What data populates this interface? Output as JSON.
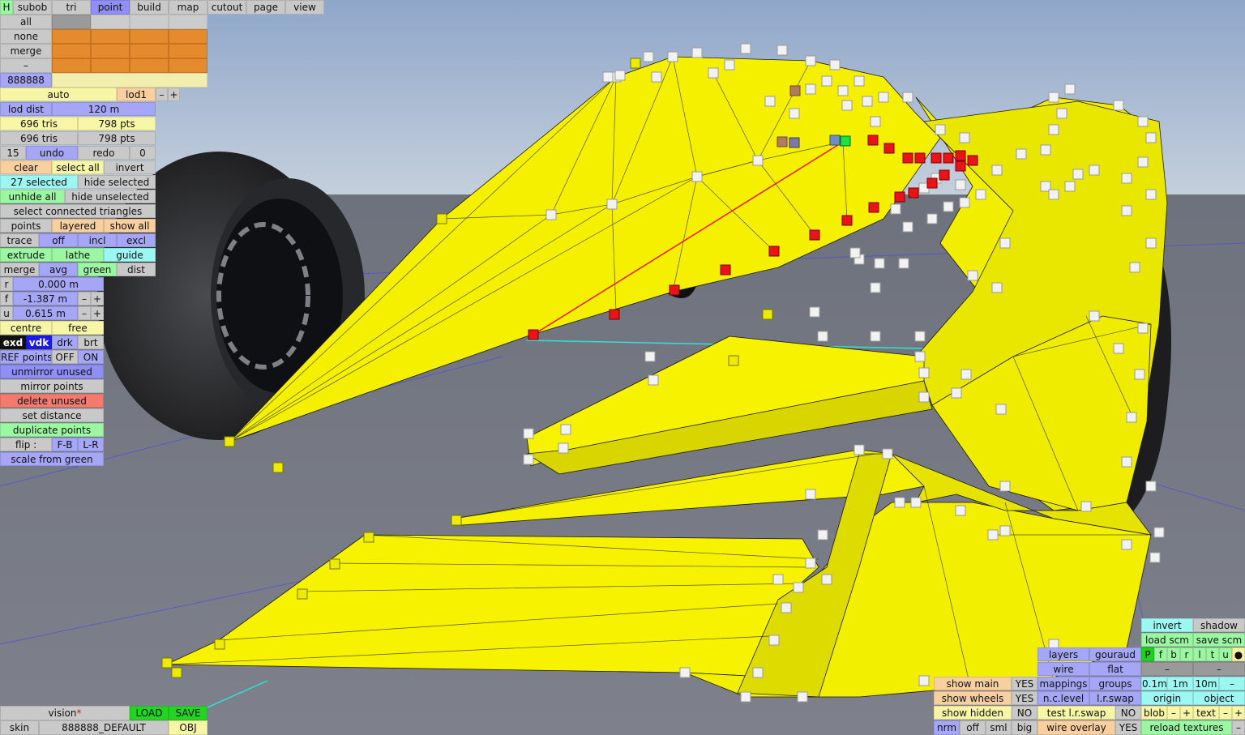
{
  "app": {
    "menu": [
      "H",
      "subob",
      "tri",
      "point",
      "build",
      "map",
      "cutout",
      "page",
      "view"
    ],
    "selectors": [
      "all",
      "none",
      "merge",
      "–"
    ],
    "hex_id": "888888"
  },
  "left_panel": {
    "auto": "auto",
    "lod": "lod1",
    "minus": "–",
    "plus": "+",
    "lod_dist_label": "lod dist",
    "lod_dist_value": "120 m",
    "tris_1": "696 tris",
    "pts_1": "798 pts",
    "tris_2": "696 tris",
    "pts_2": "798 pts",
    "undo_count": "15",
    "undo": "undo",
    "redo": "redo",
    "redo_count": "0",
    "clear": "clear",
    "select_all": "select all",
    "invert": "invert",
    "selected": "27 selected",
    "hide_selected": "hide selected",
    "unhide_all": "unhide all",
    "hide_unselected": "hide unselected",
    "select_connected": "select connected triangles",
    "points": "points",
    "layered": "layered",
    "show_all": "show all",
    "trace": "trace",
    "off": "off",
    "incl": "incl",
    "excl": "excl",
    "extrude": "extrude",
    "lathe": "lathe",
    "guide": "guide",
    "merge": "merge",
    "avg": "avg",
    "green": "green",
    "dist": "dist",
    "r_label": "r",
    "r_value": "0.000 m",
    "f_label": "f",
    "f_value": "-1.387 m",
    "u_label": "u",
    "u_value": "0.615 m",
    "centre": "centre",
    "free": "free",
    "exd": "exd",
    "vdk": "vdk",
    "drk": "drk",
    "brt": "brt",
    "ref_points": "REF points",
    "ref_off": "OFF",
    "ref_on": "ON",
    "unmirror_unused": "unmirror unused",
    "mirror_points": "mirror points",
    "delete_unused": "delete unused",
    "set_distance": "set distance",
    "duplicate_points": "duplicate points",
    "flip": "flip :",
    "flip_fb": "F-B",
    "flip_lr": "L-R",
    "scale_from_green": "scale from green"
  },
  "bottom_left": {
    "vision": "vision",
    "vision_mark": "*",
    "load": "LOAD",
    "save": "SAVE",
    "skin": "skin",
    "skin_name": "888888_DEFAULT",
    "obj": "OBJ"
  },
  "bottom_right": {
    "invert": "invert",
    "shadow": "shadow",
    "load_scm": "load scm",
    "save_scm": "save scm",
    "pfbrltu": [
      "P",
      "f",
      "b",
      "r",
      "l",
      "t",
      "u"
    ],
    "dot": "●",
    "layers": "layers",
    "gouraud": "gouraud",
    "wire": "wire",
    "flat": "flat",
    "dash1": "–",
    "dash2": "–",
    "show_main": "show main",
    "show_main_v": "YES",
    "mappings": "mappings",
    "groups": "groups",
    "d01": "0.1m",
    "d1": "1m",
    "d10": "10m",
    "dm": "–",
    "show_wheels": "show wheels",
    "show_wheels_v": "YES",
    "nc_level": "n.c.level",
    "lr_swap": "l.r.swap",
    "origin": "origin",
    "object": "object",
    "show_hidden": "show hidden",
    "show_hidden_v": "NO",
    "test_lr_swap": "test l.r.swap",
    "test_v": "NO",
    "blob": "blob",
    "blob_minus": "–",
    "blob_plus": "+",
    "text": "text",
    "text_minus": "–",
    "text_plus": "+",
    "nrm": "nrm",
    "off": "off",
    "sml": "sml",
    "big": "big",
    "wire_overlay": "wire overlay",
    "wire_overlay_v": "YES",
    "reload_textures": "reload textures",
    "reload_minus": "–"
  },
  "colors": {
    "sky": "#9fb3cf",
    "ground": "#8c8f9a",
    "mesh_yellow": "#f4f000",
    "selected_point": "#e8141a",
    "active_point": "#22e23c",
    "button_purple": "#a6a6f7",
    "button_yellow": "#f7f6a6"
  }
}
